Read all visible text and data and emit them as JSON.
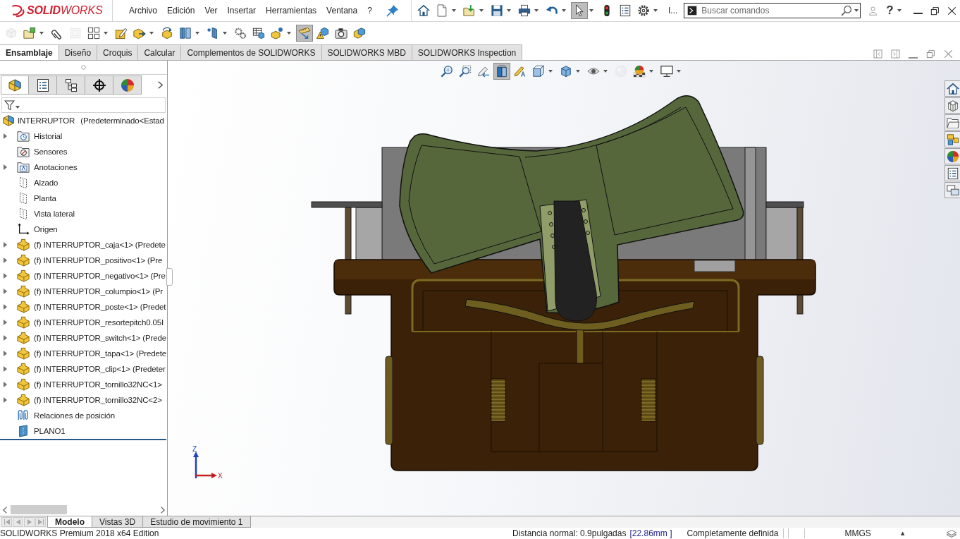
{
  "app_bar": {
    "logo": "**SOLID**WORKS",
    "menu": [
      "Archivo",
      "Edición",
      "Ver",
      "Insertar",
      "Herramientas",
      "Ventana",
      "?"
    ],
    "quick_access": [
      {
        "pressed": false,
        "dropdown": false
      },
      {
        "pressed": false,
        "dropdown": true
      },
      {
        "pressed": false,
        "dropdown": true
      },
      {
        "pressed": false,
        "dropdown": true
      },
      {
        "pressed": false,
        "dropdown": true
      },
      {
        "pressed": false,
        "dropdown": true
      },
      {
        "pressed": true,
        "dropdown": true
      },
      {
        "pressed": false,
        "dropdown": false
      },
      {
        "pressed": false,
        "dropdown": false
      },
      {
        "pressed": false,
        "dropdown": true
      }
    ],
    "overflow": "I...",
    "search": {
      "placeholder": "Buscar comandos"
    },
    "help": "?"
  },
  "command_toolbar": [
    {
      "pressed": false,
      "disabled": true,
      "dropdown": false
    },
    {
      "pressed": false,
      "disabled": false,
      "dropdown": true
    },
    {
      "pressed": false,
      "disabled": false,
      "dropdown": false
    },
    {
      "pressed": false,
      "disabled": true,
      "dropdown": false
    },
    {
      "pressed": false,
      "disabled": false,
      "dropdown": true
    },
    {
      "pressed": false,
      "disabled": false,
      "dropdown": false
    },
    {
      "pressed": false,
      "disabled": false,
      "dropdown": true
    },
    {
      "pressed": false,
      "disabled": false,
      "dropdown": false
    },
    {
      "pressed": false,
      "disabled": false,
      "dropdown": true
    },
    {
      "pressed": false,
      "disabled": false,
      "dropdown": true
    },
    {
      "pressed": false,
      "disabled": false,
      "dropdown": false
    },
    {
      "pressed": false,
      "disabled": false,
      "dropdown": false
    },
    {
      "pressed": false,
      "disabled": false,
      "dropdown": true
    },
    {
      "pressed": true,
      "disabled": false,
      "dropdown": false
    },
    {
      "pressed": false,
      "disabled": false,
      "dropdown": false
    },
    {
      "pressed": false,
      "disabled": false,
      "dropdown": false
    },
    {
      "pressed": false,
      "disabled": false,
      "dropdown": false
    }
  ],
  "command_tabs": [
    {
      "label": "Ensamblaje",
      "selected": true
    },
    {
      "label": "Diseño",
      "selected": false
    },
    {
      "label": "Croquis",
      "selected": false
    },
    {
      "label": "Calcular",
      "selected": false
    },
    {
      "label": "Complementos de SOLIDWORKS",
      "selected": false
    },
    {
      "label": "SOLIDWORKS MBD",
      "selected": false
    },
    {
      "label": "SOLIDWORKS Inspection",
      "selected": false
    }
  ],
  "feature_manager": {
    "tabs": [
      {
        "selected": true
      },
      {
        "selected": false
      },
      {
        "selected": false
      },
      {
        "selected": false
      },
      {
        "selected": false
      }
    ],
    "tree": {
      "label": "INTERRUPTOR",
      "configuration": "(Predeterminado<Estad",
      "children": [
        {
          "label": "Historial",
          "kind": "history",
          "expandable": true
        },
        {
          "label": "Sensores",
          "kind": "sensors",
          "expandable": false
        },
        {
          "label": "Anotaciones",
          "kind": "annotations",
          "expandable": true
        },
        {
          "label": "Alzado",
          "kind": "refplane",
          "expandable": false
        },
        {
          "label": "Planta",
          "kind": "refplane",
          "expandable": false
        },
        {
          "label": "Vista lateral",
          "kind": "refplane",
          "expandable": false
        },
        {
          "label": "Origen",
          "kind": "origin",
          "expandable": false
        },
        {
          "label": "(f) INTERRUPTOR_caja<1> (Predete",
          "kind": "part",
          "expandable": true
        },
        {
          "label": "(f) INTERRUPTOR_positivo<1> (Pre",
          "kind": "part",
          "expandable": true
        },
        {
          "label": "(f) INTERRUPTOR_negativo<1> (Pre",
          "kind": "part",
          "expandable": true
        },
        {
          "label": "(f) INTERRUPTOR_columpio<1> (Pr",
          "kind": "part",
          "expandable": true
        },
        {
          "label": "(f) INTERRUPTOR_poste<1> (Predet",
          "kind": "part",
          "expandable": true
        },
        {
          "label": "(f) INTERRUPTOR_resortepitch0.05I",
          "kind": "part",
          "expandable": true
        },
        {
          "label": "(f) INTERRUPTOR_switch<1> (Prede",
          "kind": "part",
          "expandable": true
        },
        {
          "label": "(f) INTERRUPTOR_tapa<1> (Predete",
          "kind": "part",
          "expandable": true
        },
        {
          "label": "(f) INTERRUPTOR_clip<1> (Predeter",
          "kind": "part",
          "expandable": true
        },
        {
          "label": "(f) INTERRUPTOR_tornillo32NC<1>",
          "kind": "part",
          "expandable": true
        },
        {
          "label": "(f) INTERRUPTOR_tornillo32NC<2>",
          "kind": "part",
          "expandable": true
        },
        {
          "label": "Relaciones de posición",
          "kind": "mates",
          "expandable": false
        },
        {
          "label": "PLANO1",
          "kind": "plane",
          "expandable": false
        }
      ]
    }
  },
  "view_toolbar": [
    {
      "pressed": false,
      "disabled": false,
      "dropdown": false
    },
    {
      "pressed": false,
      "disabled": false,
      "dropdown": false
    },
    {
      "pressed": false,
      "disabled": false,
      "dropdown": false
    },
    {
      "pressed": true,
      "disabled": false,
      "dropdown": false
    },
    {
      "pressed": false,
      "disabled": false,
      "dropdown": false
    },
    {
      "pressed": false,
      "disabled": false,
      "dropdown": true
    },
    {
      "pressed": false,
      "disabled": false,
      "dropdown": true
    },
    {
      "pressed": false,
      "disabled": false,
      "dropdown": true
    },
    {
      "pressed": false,
      "disabled": true,
      "dropdown": false
    },
    {
      "pressed": false,
      "disabled": false,
      "dropdown": true
    },
    {
      "pressed": false,
      "disabled": false,
      "dropdown": true
    }
  ],
  "triad": {
    "vertical_axis": "Z",
    "horizontal_axis": "X"
  },
  "bottom_tabs": [
    {
      "label": "Modelo",
      "selected": true
    },
    {
      "label": "Vistas 3D",
      "selected": false
    },
    {
      "label": "Estudio de movimiento 1",
      "selected": false
    }
  ],
  "status_bar": {
    "product": "SOLIDWORKS Premium 2018 x64 Edition",
    "measurement": "Distancia normal: 0.9pulgadas",
    "measurement_metric": "[22.86mm ]",
    "definition": "Completamente definida",
    "units": "MMGS",
    "units_arrow": "▲"
  }
}
